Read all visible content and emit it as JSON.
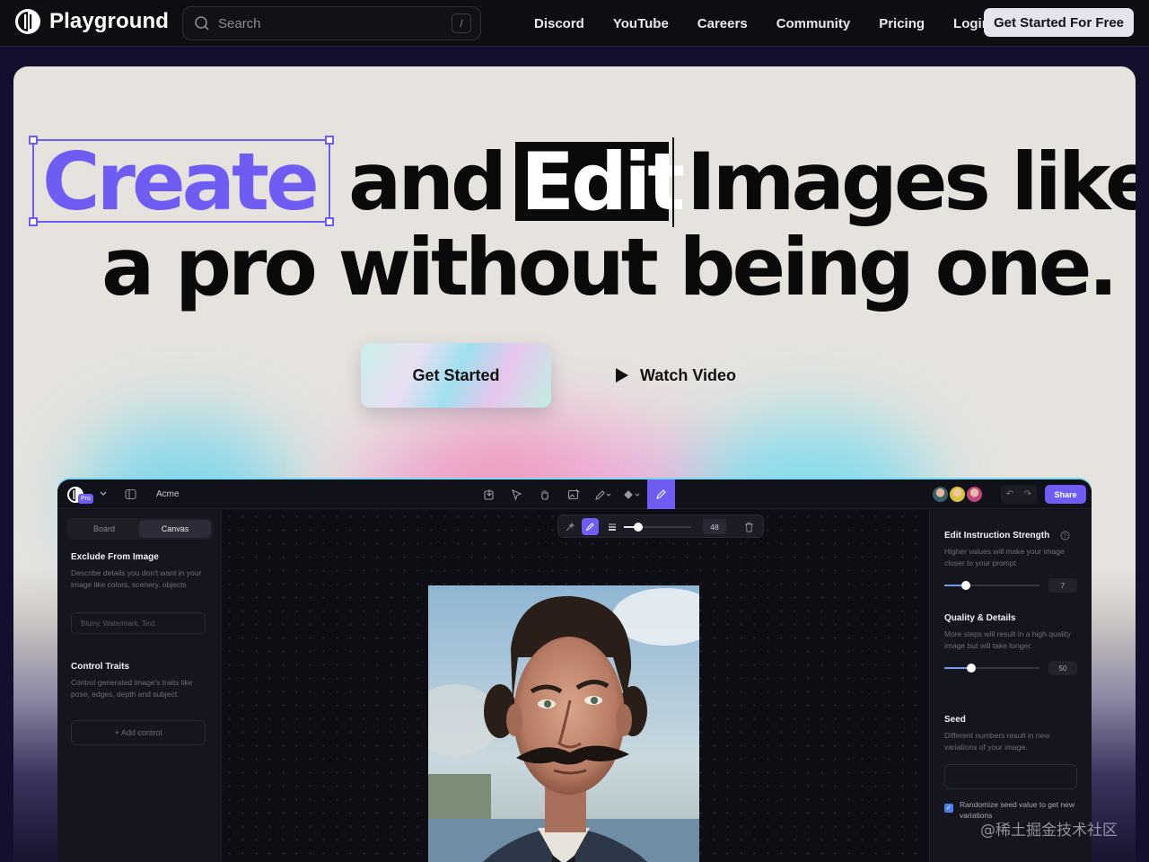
{
  "nav": {
    "brand": "Playground",
    "search_placeholder": "Search",
    "search_shortcut": "/",
    "links": [
      "Discord",
      "YouTube",
      "Careers",
      "Community",
      "Pricing",
      "Login"
    ],
    "cta": "Get Started For Free"
  },
  "hero": {
    "word_create": "Create",
    "word_and": "and",
    "word_edit": "Edit",
    "words_images_like": "Images like",
    "line2": "a pro without being one.",
    "primary_button": "Get Started",
    "secondary_button": "Watch Video",
    "accent_color": "#6f5cf2"
  },
  "app": {
    "pro_badge": "Pro",
    "project_name": "Acme",
    "share_label": "Share",
    "brush_size": "48",
    "left": {
      "tabs": [
        "Board",
        "Canvas"
      ],
      "active_tab": "Canvas",
      "exclude_title": "Exclude From Image",
      "exclude_desc": "Describe details you don't want in your image like colors, scenery, objects",
      "exclude_placeholder": "Blurry, Watermark, Text",
      "control_title": "Control Traits",
      "control_desc": "Control generated image's traits like pose, edges, depth and subject.",
      "add_control": "+ Add control"
    },
    "right": {
      "strength_title": "Edit Instruction Strength",
      "strength_desc": "Higher values will make your image closer to your prompt",
      "strength_value": "7",
      "quality_title": "Quality & Details",
      "quality_desc": "More steps will result in a high quality image but will take longer.",
      "quality_value": "50",
      "seed_title": "Seed",
      "seed_desc": "Different numbers result in new variations of your image.",
      "randomize_label": "Randomize seed value to get new variations",
      "randomize_checked": true
    }
  },
  "watermark": "@稀土掘金技术社区"
}
